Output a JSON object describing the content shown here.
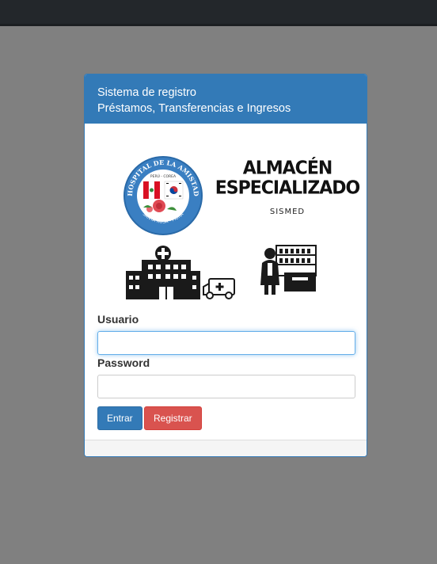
{
  "panel": {
    "title_line1": "Sistema de registro",
    "title_line2": "Préstamos, Transferencias e Ingresos"
  },
  "logos": {
    "hospital_text_top": "HOSPITAL DE LA AMISTAD",
    "hospital_text_mid": "PERÚ - COREA",
    "hospital_text_bottom": "SANTA ROSA - PIURA",
    "almacen_line1": "ALMACÉN",
    "almacen_line2": "ESPECIALIZADO",
    "almacen_sub": "SISMED"
  },
  "form": {
    "usuario_label": "Usuario",
    "usuario_value": "",
    "password_label": "Password",
    "password_value": "",
    "entrar_label": "Entrar",
    "registrar_label": "Registrar"
  },
  "colors": {
    "primary": "#337ab7",
    "danger": "#d9534f",
    "background": "#808080",
    "topbar": "#23272b"
  },
  "icons": [
    "hospital-building-icon",
    "ambulance-icon",
    "pharmacist-icon"
  ]
}
